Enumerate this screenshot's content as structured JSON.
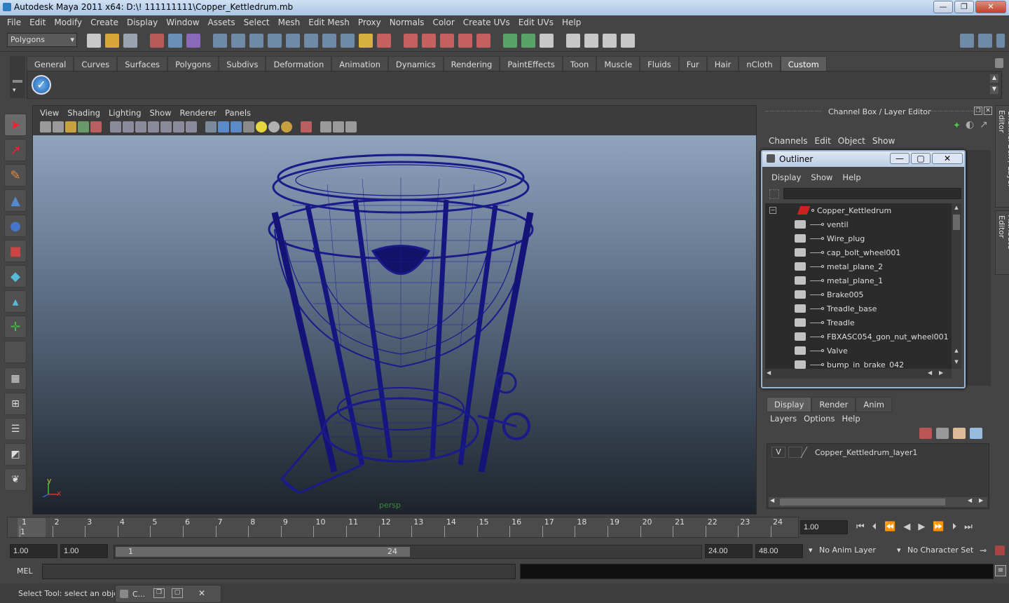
{
  "window": {
    "title": "Autodesk Maya 2011 x64: D:\\! 111111111\\Copper_Kettledrum.mb",
    "min": "—",
    "max": "❐",
    "close": "✕"
  },
  "menubar": [
    "File",
    "Edit",
    "Modify",
    "Create",
    "Display",
    "Window",
    "Assets",
    "Select",
    "Mesh",
    "Edit Mesh",
    "Proxy",
    "Normals",
    "Color",
    "Create UVs",
    "Edit UVs",
    "Help"
  ],
  "status": {
    "menuset": "Polygons"
  },
  "shelf": {
    "tabs": [
      "General",
      "Curves",
      "Surfaces",
      "Polygons",
      "Subdivs",
      "Deformation",
      "Animation",
      "Dynamics",
      "Rendering",
      "PaintEffects",
      "Toon",
      "Muscle",
      "Fluids",
      "Fur",
      "Hair",
      "nCloth",
      "Custom"
    ],
    "active": "Custom"
  },
  "viewport": {
    "menu": [
      "View",
      "Shading",
      "Lighting",
      "Show",
      "Renderer",
      "Panels"
    ],
    "camera": "persp",
    "axis_y": "y",
    "axis_x": "x"
  },
  "channelbox": {
    "title": "Channel Box / Layer Editor",
    "menu": [
      "Channels",
      "Edit",
      "Object",
      "Show"
    ]
  },
  "outliner": {
    "title": "Outliner",
    "menu": [
      "Display",
      "Show",
      "Help"
    ],
    "root": "Copper_Kettledrum",
    "items": [
      "ventil",
      "Wire_plug",
      "cap_bolt_wheel001",
      "metal_plane_2",
      "metal_plane_1",
      "Brake005",
      "Treadle_base",
      "Treadle",
      "FBXASC054_gon_nut_wheel001",
      "Valve",
      "bump_in_brake_042"
    ]
  },
  "layers": {
    "tabs": [
      "Display",
      "Render",
      "Anim"
    ],
    "active": "Display",
    "menu": [
      "Layers",
      "Options",
      "Help"
    ],
    "rows": [
      {
        "vis": "V",
        "name": "Copper_Kettledrum_layer1"
      }
    ]
  },
  "sidetabs": [
    "Channel Box / Layer Editor",
    "Attribute Editor"
  ],
  "timeline": {
    "ticks": [
      "1",
      "2",
      "3",
      "4",
      "5",
      "6",
      "7",
      "8",
      "9",
      "10",
      "11",
      "12",
      "13",
      "14",
      "15",
      "16",
      "17",
      "18",
      "19",
      "20",
      "21",
      "22",
      "23",
      "24"
    ],
    "current": "1",
    "current_field": "1.00"
  },
  "range": {
    "start": "1.00",
    "start2": "1.00",
    "slider_start": "1",
    "slider_end": "24",
    "end": "24.00",
    "end2": "48.00",
    "anim_layer": "No Anim Layer",
    "char_set": "No Character Set"
  },
  "mel": {
    "label": "MEL"
  },
  "help": {
    "text": "Select Tool: select an object",
    "minimized": "C..."
  }
}
